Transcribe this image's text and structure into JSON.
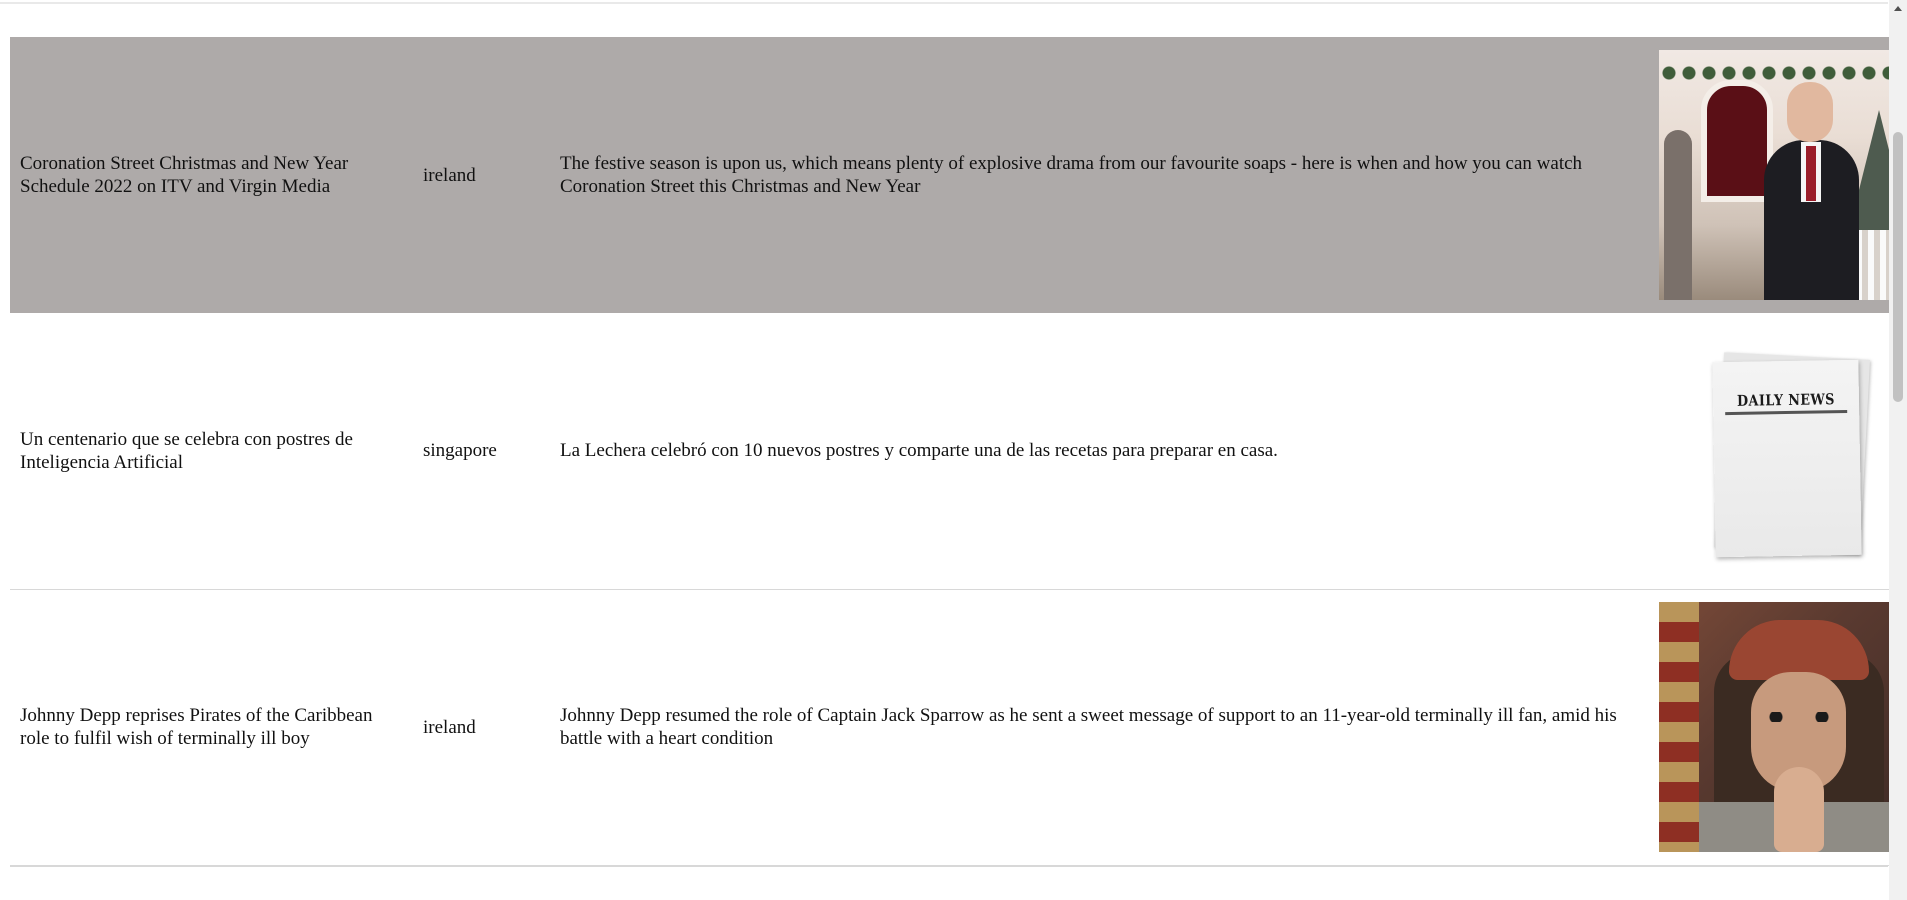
{
  "articles": [
    {
      "title": "Coronation Street Christmas and New Year Schedule 2022 on ITV and Virgin Media",
      "country": "ireland",
      "description": "The festive season is upon us, which means plenty of explosive drama from our favourite soaps - here is when and how you can watch Coronation Street this Christmas and New Year",
      "image": "wedding-photo",
      "highlighted": true
    },
    {
      "title": "Un centenario que se celebra con postres de Inteligencia Artificial",
      "country": "singapore",
      "description": "La Lechera celebró con 10 nuevos postres y comparte una de las recetas para preparar en casa.",
      "image": "newspaper-placeholder",
      "image_text": "DAILY NEWS",
      "highlighted": false
    },
    {
      "title": "Johnny Depp reprises Pirates of the Caribbean role to fulfil wish of terminally ill boy",
      "country": "ireland",
      "description": "Johnny Depp resumed the role of Captain Jack Sparrow as he sent a sweet message of support to an 11-year-old terminally ill fan, amid his battle with a heart condition",
      "image": "pirate-portrait-photo",
      "highlighted": false
    }
  ],
  "colors": {
    "highlight_row": "#aeaaa9",
    "row_divider": "#d8d8d8",
    "background": "#ffffff"
  }
}
